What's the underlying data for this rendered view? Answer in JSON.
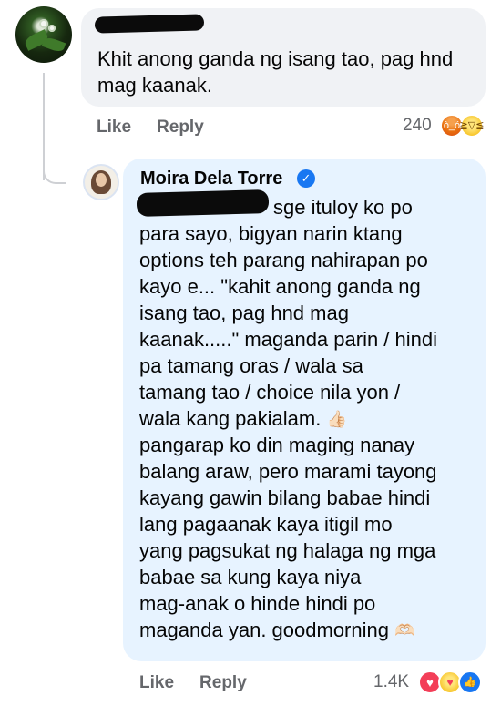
{
  "comment": {
    "text": "Khit anong ganda ng isang tao, pag hnd mag kaanak.",
    "actions": {
      "like": "Like",
      "reply": "Reply"
    },
    "reaction_count": "240",
    "reactions": [
      "angry-icon",
      "haha-icon"
    ]
  },
  "reply": {
    "author": "Moira Dela Torre",
    "verified_icon": "verified-badge-icon",
    "lines": [
      "sge ituloy ko po",
      "para sayo, bigyan narin ktang",
      "options teh parang nahirapan po",
      "kayo e... \"kahit anong ganda ng",
      "isang tao, pag hnd mag",
      "kaanak.....\" maganda parin / hindi",
      "pa tamang oras / wala sa",
      "tamang tao / choice nila yon /",
      "wala kang pakialam.",
      "pangarap ko din maging nanay",
      "balang araw, pero marami tayong",
      "kayang gawin bilang babae hindi",
      "lang pagaanak kaya itigil mo",
      "yang pagsukat ng halaga ng mga",
      "babae sa kung kaya niya",
      "mag-anak o hinde hindi po",
      "maganda yan. goodmorning"
    ],
    "emoji_thumbs": "👍🏻",
    "emoji_heart_hands": "🫶🏻",
    "actions": {
      "like": "Like",
      "reply": "Reply"
    },
    "reaction_count": "1.4K",
    "reactions": [
      "love-icon",
      "care-icon",
      "like-icon"
    ]
  }
}
